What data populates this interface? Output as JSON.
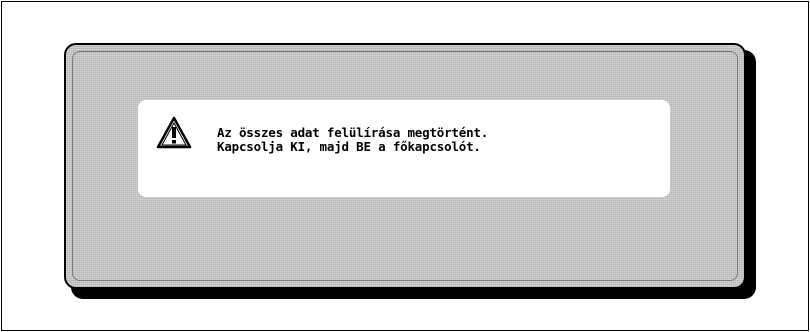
{
  "dialog": {
    "icon": "warning-triangle-icon",
    "message_line1": "Az összes adat felülírása megtörtént.",
    "message_line2": "Kapcsolja KI, majd BE a főkapcsolót."
  },
  "colors": {
    "background": "#ffffff",
    "panel_fill": "#c8c8c8",
    "panel_border": "#000000",
    "message_box": "#ffffff",
    "text": "#000000"
  }
}
